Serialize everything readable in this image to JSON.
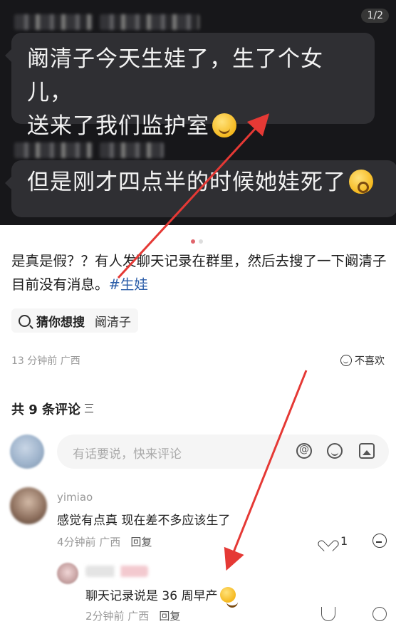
{
  "image": {
    "page_indicator": "1/2",
    "bubble1_line1": "阚清子今天生娃了，生了个女儿，",
    "bubble1_line2": "送来了我们监护室",
    "bubble1_emoji": "laughing-crying-emoji",
    "bubble2_text": "但是刚才四点半的时候她娃死了",
    "bubble2_emoji": "shocked-emoji"
  },
  "post": {
    "text": "是真是假？？有人发聊天记录在群里，然后去搜了一下阚清子目前没有消息。",
    "hashtag": "#生娃",
    "guess_label": "猜你想搜",
    "guess_keyword": "阚清子",
    "time_location": "13 分钟前  广西",
    "dislike_label": "不喜欢"
  },
  "comments_header": "共 9 条评论",
  "comment_input": {
    "placeholder": "有话要说，快来评论"
  },
  "comment": {
    "username": "yimiao",
    "text": "感觉有点真 现在差不多应该生了",
    "time_location": "4分钟前  广西",
    "reply_label": "回复",
    "like_count": "1"
  },
  "reply": {
    "text": "聊天记录说是 36 周早产",
    "time_location": "2分钟前  广西",
    "reply_label": "回复"
  },
  "colors": {
    "accent": "#e0656c",
    "hashtag": "#2b5da8",
    "annotation_arrow": "#e53935"
  }
}
